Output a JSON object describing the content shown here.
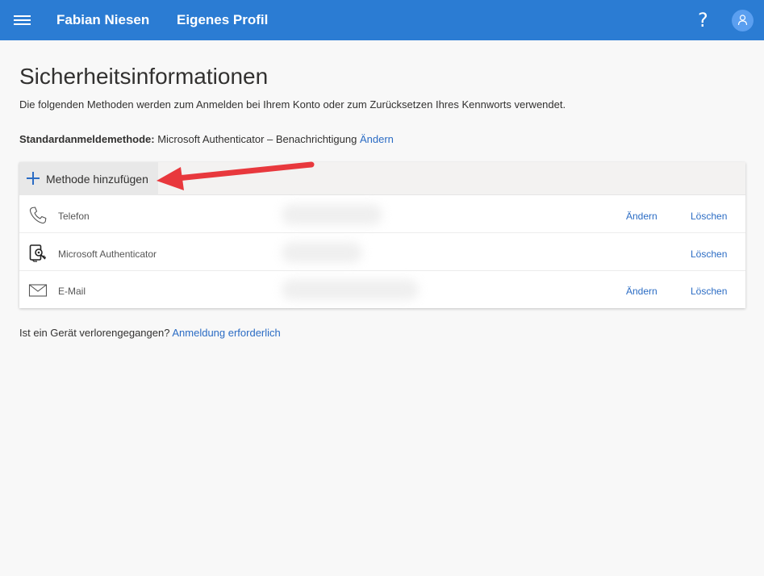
{
  "header": {
    "user_name": "Fabian Niesen",
    "profile_link": "Eigenes Profil",
    "help_symbol": "?",
    "menu_icon": "hamburger-icon",
    "avatar_icon": "person-icon",
    "bar_color": "#2b7cd3"
  },
  "main": {
    "title": "Sicherheitsinformationen",
    "description": "Die folgenden Methoden werden zum Anmelden bei Ihrem Konto oder zum Zurücksetzen Ihres Kennworts verwendet.",
    "default_method_label": "Standardanmeldemethode:",
    "default_method_value": " Microsoft Authenticator – Benachrichtigung ",
    "default_method_change": "Ändern"
  },
  "methods": {
    "add_label": "Methode hinzufügen",
    "items": [
      {
        "icon": "phone-icon",
        "name": "Telefon",
        "change_label": "Ändern",
        "delete_label": "Löschen"
      },
      {
        "icon": "authenticator-icon",
        "name": "Microsoft Authenticator",
        "delete_label": "Löschen"
      },
      {
        "icon": "mail-icon",
        "name": "E-Mail",
        "change_label": "Ändern",
        "delete_label": "Löschen"
      }
    ]
  },
  "footer": {
    "lost_device_text": "Ist ein Gerät verlorengegangen? ",
    "lost_device_link": "Anmeldung erforderlich"
  },
  "annotation": {
    "arrow_color": "#e8383d"
  }
}
